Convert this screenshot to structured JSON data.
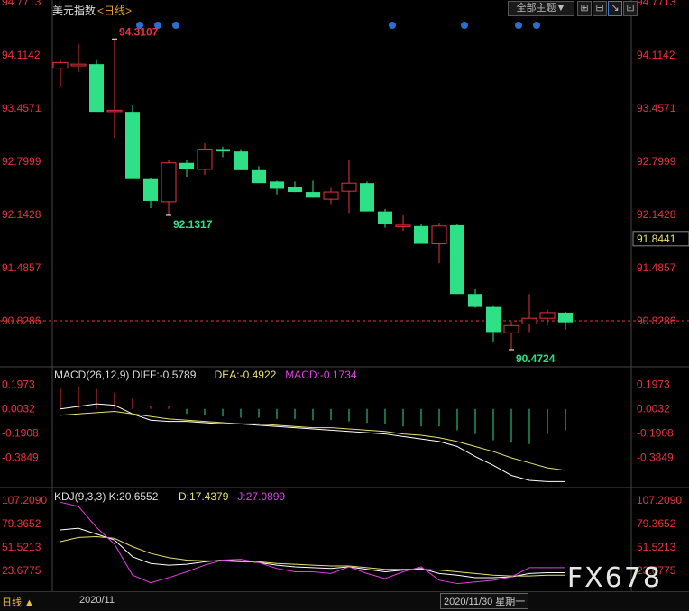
{
  "header": {
    "title": "美元指数",
    "period": "<日线>",
    "theme_button": "全部主题▼",
    "tool_buttons": [
      "⊞",
      "⊟",
      "↘",
      "⊡"
    ]
  },
  "colors": {
    "up": "#e8323c",
    "down": "#2ee086",
    "diff": "#ffffff",
    "dea": "#e8e070",
    "macd_label": "#e040e0",
    "j": "#e040e0",
    "marker": "#2a6fd0"
  },
  "chart_data": [
    {
      "type": "candlestick",
      "title": "美元指数",
      "y_ticks": [
        "94.7713",
        "94.1142",
        "93.4571",
        "92.7999",
        "92.1428",
        "91.4857",
        "90.8286"
      ],
      "ylim": [
        90.45,
        94.77
      ],
      "current_price": "91.8441",
      "reference_line": "90.8286",
      "annotations": [
        {
          "text": "94.3107",
          "value": 94.3107,
          "candle": 3
        },
        {
          "text": "92.1317",
          "value": 92.1317,
          "candle": 6
        },
        {
          "text": "90.4724",
          "value": 90.4724,
          "candle": 25
        }
      ],
      "event_markers": [
        5,
        6,
        7,
        19,
        23,
        26,
        27
      ],
      "candles": [
        {
          "o": 93.95,
          "h": 94.05,
          "l": 93.72,
          "c": 94.02
        },
        {
          "o": 93.98,
          "h": 94.25,
          "l": 93.9,
          "c": 94.0
        },
        {
          "o": 94.0,
          "h": 94.05,
          "l": 93.41,
          "c": 93.41
        },
        {
          "o": 93.43,
          "h": 94.31,
          "l": 93.09,
          "c": 93.43
        },
        {
          "o": 93.41,
          "h": 93.5,
          "l": 92.6,
          "c": 92.58
        },
        {
          "o": 92.58,
          "h": 92.6,
          "l": 92.22,
          "c": 92.31
        },
        {
          "o": 92.3,
          "h": 92.82,
          "l": 92.13,
          "c": 92.78
        },
        {
          "o": 92.78,
          "h": 92.82,
          "l": 92.61,
          "c": 92.7
        },
        {
          "o": 92.7,
          "h": 93.02,
          "l": 92.63,
          "c": 92.95
        },
        {
          "o": 92.95,
          "h": 92.98,
          "l": 92.85,
          "c": 92.92
        },
        {
          "o": 92.92,
          "h": 92.95,
          "l": 92.69,
          "c": 92.69
        },
        {
          "o": 92.69,
          "h": 92.74,
          "l": 92.53,
          "c": 92.53
        },
        {
          "o": 92.55,
          "h": 92.56,
          "l": 92.39,
          "c": 92.46
        },
        {
          "o": 92.48,
          "h": 92.55,
          "l": 92.42,
          "c": 92.42
        },
        {
          "o": 92.42,
          "h": 92.56,
          "l": 92.35,
          "c": 92.35
        },
        {
          "o": 92.33,
          "h": 92.47,
          "l": 92.27,
          "c": 92.42
        },
        {
          "o": 92.43,
          "h": 92.81,
          "l": 92.16,
          "c": 92.53
        },
        {
          "o": 92.53,
          "h": 92.55,
          "l": 92.18,
          "c": 92.18
        },
        {
          "o": 92.18,
          "h": 92.21,
          "l": 91.98,
          "c": 92.02
        },
        {
          "o": 92.01,
          "h": 92.13,
          "l": 91.94,
          "c": 92.01
        },
        {
          "o": 92.0,
          "h": 92.02,
          "l": 91.79,
          "c": 91.78
        },
        {
          "o": 91.78,
          "h": 92.04,
          "l": 91.54,
          "c": 92.0
        },
        {
          "o": 92.01,
          "h": 92.02,
          "l": 91.16,
          "c": 91.16
        },
        {
          "o": 91.16,
          "h": 91.22,
          "l": 90.99,
          "c": 91.0
        },
        {
          "o": 91.0,
          "h": 91.02,
          "l": 90.56,
          "c": 90.69
        },
        {
          "o": 90.68,
          "h": 90.82,
          "l": 90.47,
          "c": 90.77
        },
        {
          "o": 90.79,
          "h": 91.16,
          "l": 90.69,
          "c": 90.86
        },
        {
          "o": 90.86,
          "h": 90.97,
          "l": 90.77,
          "c": 90.93
        },
        {
          "o": 90.93,
          "h": 90.94,
          "l": 90.72,
          "c": 90.81
        }
      ]
    },
    {
      "type": "macd",
      "title": "MACD(26,12,9)",
      "diff_label": "DIFF:-0.5789",
      "dea_label": "DEA:-0.4922",
      "macd_label": "MACD:-0.1734",
      "y_ticks": [
        "0.1973",
        "0.0032",
        "-0.1908",
        "-0.3849"
      ],
      "ylim": [
        -0.62,
        0.3
      ],
      "hist": [
        0.16,
        0.18,
        0.16,
        0.13,
        0.08,
        0.02,
        0.02,
        -0.04,
        -0.05,
        -0.06,
        -0.07,
        -0.07,
        -0.08,
        -0.08,
        -0.09,
        -0.09,
        -0.1,
        -0.11,
        -0.12,
        -0.14,
        -0.14,
        -0.14,
        -0.17,
        -0.2,
        -0.25,
        -0.27,
        -0.28,
        -0.2,
        -0.17
      ],
      "diff": [
        0.0,
        0.02,
        0.04,
        0.03,
        -0.04,
        -0.09,
        -0.1,
        -0.1,
        -0.11,
        -0.12,
        -0.12,
        -0.13,
        -0.14,
        -0.15,
        -0.16,
        -0.17,
        -0.18,
        -0.19,
        -0.2,
        -0.22,
        -0.24,
        -0.26,
        -0.3,
        -0.38,
        -0.45,
        -0.53,
        -0.57,
        -0.58,
        -0.58
      ],
      "dea": [
        -0.05,
        -0.04,
        -0.03,
        -0.02,
        -0.04,
        -0.06,
        -0.08,
        -0.09,
        -0.1,
        -0.11,
        -0.12,
        -0.12,
        -0.13,
        -0.14,
        -0.15,
        -0.15,
        -0.16,
        -0.17,
        -0.18,
        -0.2,
        -0.21,
        -0.23,
        -0.26,
        -0.3,
        -0.34,
        -0.39,
        -0.43,
        -0.47,
        -0.49
      ]
    },
    {
      "type": "kdj",
      "title": "KDJ(9,3,3)",
      "k_label": "K:20.6552",
      "d_label": "D:17.4379",
      "j_label": "J:27.0899",
      "y_ticks": [
        "107.2090",
        "79.3652",
        "51.5213",
        "23.6775"
      ],
      "ylim": [
        0,
        115
      ],
      "k": [
        72,
        74,
        67,
        60,
        40,
        32,
        30,
        31,
        34,
        36,
        35,
        33,
        30,
        28,
        27,
        26,
        28,
        25,
        22,
        24,
        26,
        20,
        18,
        15,
        15,
        16,
        20,
        21,
        21
      ],
      "d": [
        58,
        63,
        64,
        62,
        52,
        44,
        39,
        36,
        35,
        35,
        34,
        34,
        32,
        31,
        30,
        29,
        29,
        27,
        25,
        25,
        25,
        24,
        22,
        20,
        18,
        17,
        17,
        18,
        18
      ],
      "j": [
        105,
        100,
        75,
        55,
        18,
        9,
        15,
        22,
        30,
        36,
        37,
        33,
        26,
        22,
        22,
        20,
        28,
        20,
        14,
        22,
        28,
        12,
        8,
        10,
        12,
        16,
        27,
        27,
        27
      ]
    }
  ],
  "footer": {
    "period_label": "日线 ▲",
    "month_label": "2020/11",
    "cursor_date": "2020/11/30 星期一"
  },
  "watermark": "FX678"
}
